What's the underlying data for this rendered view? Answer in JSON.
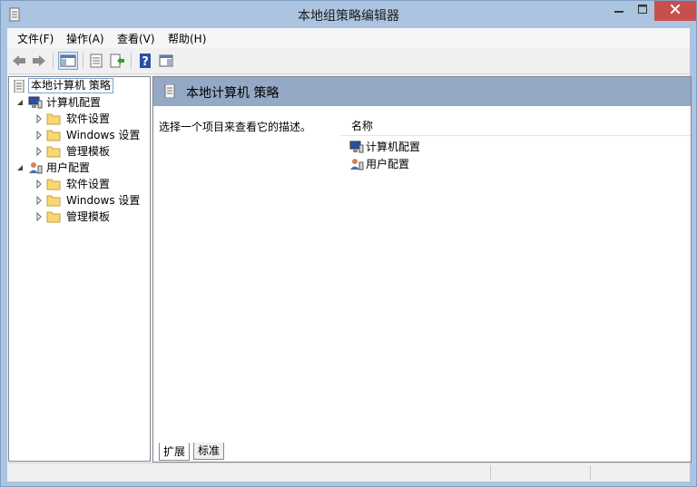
{
  "window": {
    "title": "本地组策略编辑器",
    "close_color": "#c7504c",
    "frame_color": "#abc4e0"
  },
  "menu": [
    {
      "label": "文件(F)"
    },
    {
      "label": "操作(A)"
    },
    {
      "label": "查看(V)"
    },
    {
      "label": "帮助(H)"
    }
  ],
  "toolbar": {
    "buttons": [
      "back-arrow-icon",
      "forward-arrow-icon",
      "show-hide-tree-icon",
      "properties-icon",
      "export-list-icon",
      "help-icon",
      "show-hide-action-pane-icon"
    ]
  },
  "tree": {
    "root": "本地计算机 策略",
    "computer_config": "计算机配置",
    "user_config": "用户配置",
    "software_settings": "软件设置",
    "windows_settings": "Windows 设置",
    "admin_templates": "管理模板"
  },
  "content": {
    "header_title": "本地计算机 策略",
    "description": "选择一个项目来查看它的描述。",
    "column_name": "名称",
    "items": [
      "计算机配置",
      "用户配置"
    ],
    "header_color": "#94a9c5"
  },
  "tabs": [
    {
      "label": "扩展"
    },
    {
      "label": "标准"
    }
  ]
}
